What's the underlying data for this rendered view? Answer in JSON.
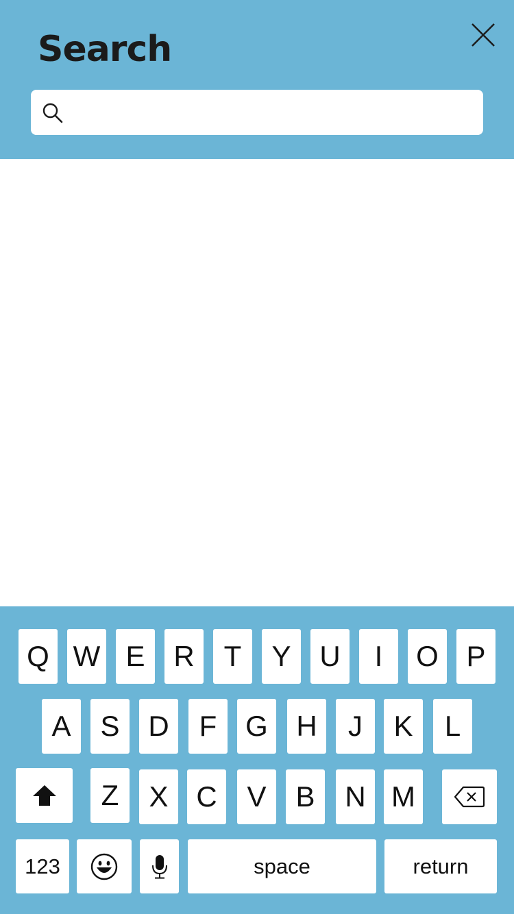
{
  "header": {
    "title": "Search",
    "close_icon": "close-icon",
    "search": {
      "icon": "search-icon",
      "value": "",
      "placeholder": ""
    }
  },
  "keyboard": {
    "row1": [
      "Q",
      "W",
      "E",
      "R",
      "T",
      "Y",
      "U",
      "I",
      "O",
      "P"
    ],
    "row2": [
      "A",
      "S",
      "D",
      "F",
      "G",
      "H",
      "J",
      "K",
      "L"
    ],
    "row3": [
      "Z",
      "X",
      "C",
      "V",
      "B",
      "N",
      "M"
    ],
    "shift_icon": "shift-icon",
    "backspace_icon": "backspace-icon",
    "numbers_label": "123",
    "emoji_icon": "emoji-icon",
    "mic_icon": "microphone-icon",
    "space_label": "space",
    "return_label": "return"
  },
  "colors": {
    "accent": "#6bb5d6",
    "key": "#ffffff",
    "text": "#1b1b1b"
  }
}
